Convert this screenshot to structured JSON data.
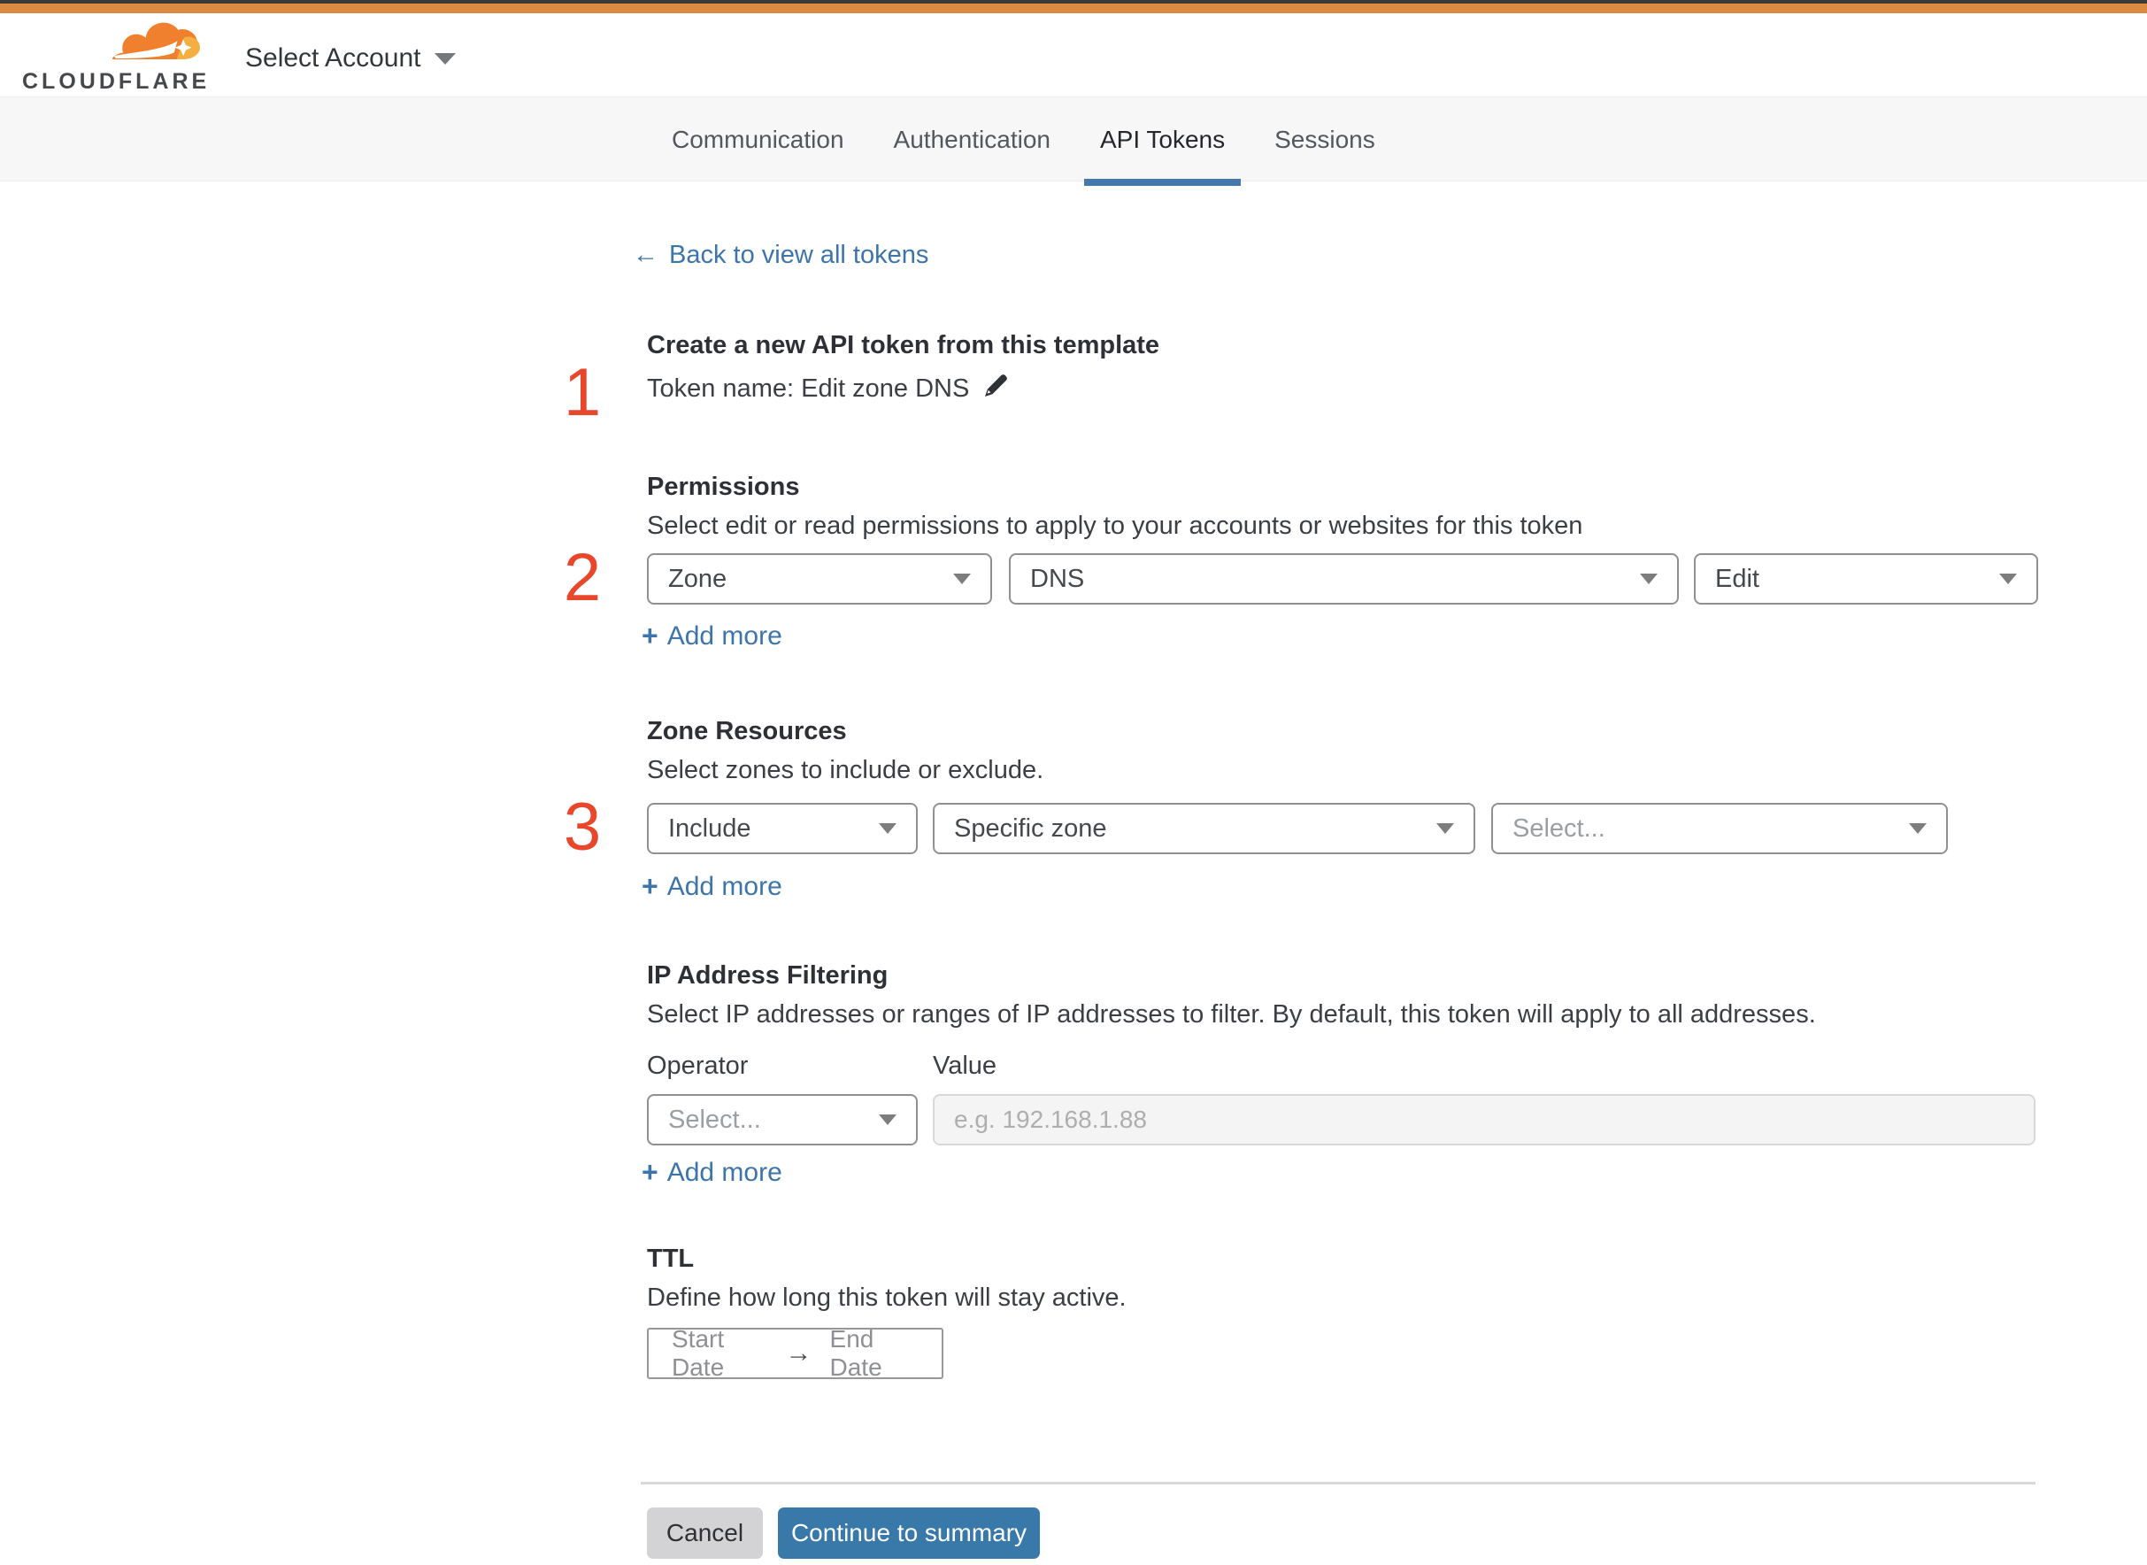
{
  "brand": {
    "wordmark": "CLOUDFLARE",
    "account_selector": "Select Account"
  },
  "tabs": [
    {
      "label": "Communication",
      "active": false
    },
    {
      "label": "Authentication",
      "active": false
    },
    {
      "label": "API Tokens",
      "active": true
    },
    {
      "label": "Sessions",
      "active": false
    }
  ],
  "back": {
    "arrow": "←",
    "label": "Back to view all tokens"
  },
  "markers": {
    "one": "1",
    "two": "2",
    "three": "3"
  },
  "token": {
    "title": "Create a new API token from this template",
    "name_line": "Token name: Edit zone DNS"
  },
  "permissions": {
    "title": "Permissions",
    "description": "Select edit or read permissions to apply to your accounts or websites for this token",
    "scope_value": "Zone",
    "resource_value": "DNS",
    "access_value": "Edit",
    "plus": "+",
    "add_more": "Add more"
  },
  "zone_resources": {
    "title": "Zone Resources",
    "description": "Select zones to include or exclude.",
    "mode_value": "Include",
    "scope_value": "Specific zone",
    "zone_placeholder": "Select...",
    "plus": "+",
    "add_more": "Add more"
  },
  "ip_filtering": {
    "title": "IP Address Filtering",
    "description": "Select IP addresses or ranges of IP addresses to filter. By default, this token will apply to all addresses.",
    "operator_label": "Operator",
    "value_label": "Value",
    "operator_placeholder": "Select...",
    "value_placeholder": "e.g. 192.168.1.88",
    "plus": "+",
    "add_more": "Add more"
  },
  "ttl": {
    "title": "TTL",
    "description": "Define how long this token will stay active.",
    "start_placeholder": "Start Date",
    "arrow": "→",
    "end_placeholder": "End Date"
  },
  "footer": {
    "cancel": "Cancel",
    "continue": "Continue to summary"
  },
  "colors": {
    "top_bar_orange": "#dd8b41",
    "logo_orange": "#f0802d",
    "logo_light_orange": "#f5ae42",
    "accent_blue": "#3879aa",
    "tab_underline_blue": "#4579ab",
    "link_blue": "#3d74a9",
    "step_marker_red": "#e9472b"
  }
}
